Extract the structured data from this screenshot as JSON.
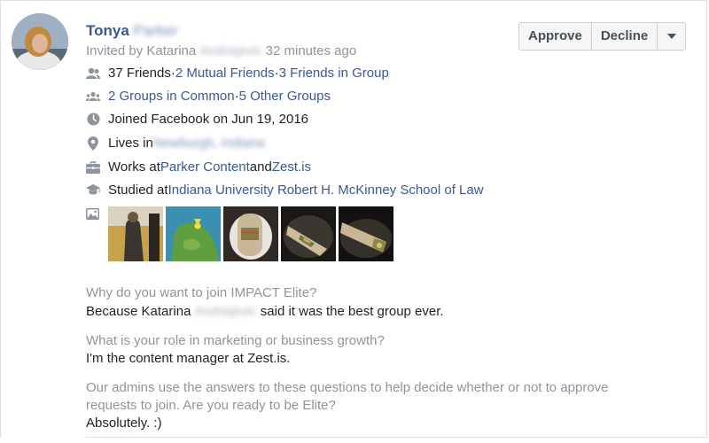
{
  "header": {
    "first_name": "Tonya",
    "last_name": "Parker",
    "invited_prefix": "Invited by Katarina",
    "invited_blur": "Andrejevic",
    "invited_time": "32 minutes ago"
  },
  "actions": {
    "approve": "Approve",
    "decline": "Decline"
  },
  "info": {
    "friends": "37 Friends",
    "dot": " · ",
    "mutual_friends": "2 Mutual Friends",
    "friends_in_group": "3 Friends in Group",
    "groups_in_common": "2 Groups in Common",
    "other_groups": "5 Other Groups",
    "joined": "Joined Facebook on Jun 19, 2016",
    "lives_prefix": "Lives in ",
    "lives_place": "Newburgh, Indiana",
    "works_prefix": "Works at ",
    "work1": "Parker Content",
    "works_and": " and ",
    "work2": "Zest.is",
    "studied_prefix": "Studied at ",
    "school": "Indiana University Robert H. McKinney School of Law"
  },
  "questions": {
    "q1": "Why do you want to join IMPACT Elite?",
    "a1_prefix": "Because Katarina ",
    "a1_blur": "Andrejevic",
    "a1_suffix": " said it was the best group ever.",
    "q2": "What is your role in marketing or business growth?",
    "a2": "I'm the content manager at Zest.is.",
    "q3_line1": "Our admins use the answers to these questions to help decide whether or not to approve",
    "q3_line2": "requests to join. Are you ready to be Elite?",
    "a3": "Absolutely. :)"
  },
  "icons": [
    "friends-icon",
    "groups-icon",
    "clock-icon",
    "location-pin-icon",
    "briefcase-icon",
    "graduation-cap-icon",
    "photo-icon",
    "caret-down-icon"
  ],
  "colors": {
    "link": "#385898",
    "muted": "#90949c",
    "text": "#1d2129",
    "icon": "#8d949e"
  }
}
